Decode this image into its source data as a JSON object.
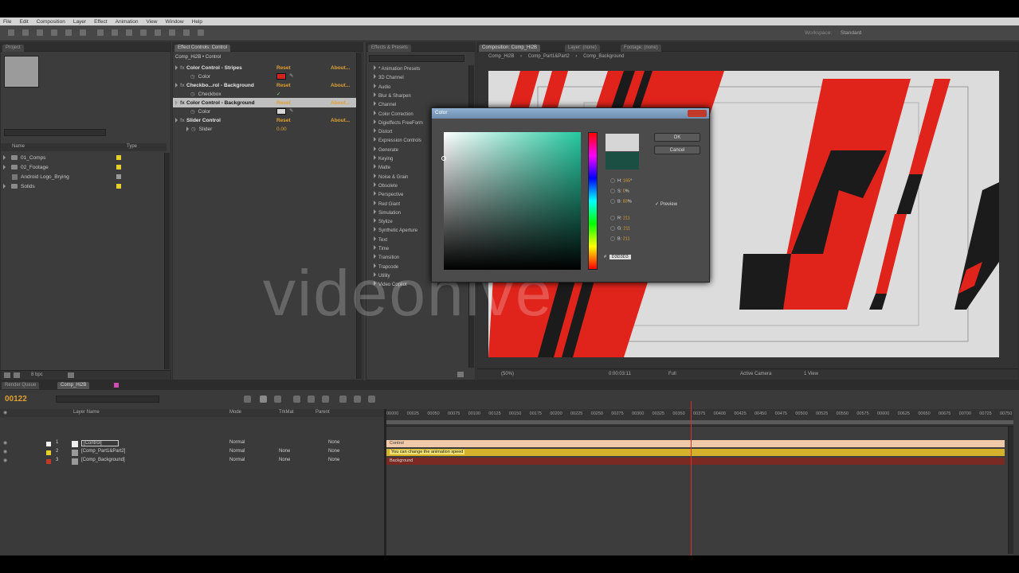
{
  "menubar": {
    "items": [
      "File",
      "Edit",
      "Composition",
      "Layer",
      "Effect",
      "Animation",
      "View",
      "Window",
      "Help"
    ]
  },
  "toolbar": {
    "workspace_label": "Workspace:",
    "workspace_value": "Standard"
  },
  "project": {
    "tab": "Project",
    "search_placeholder": "",
    "col_name": "Name",
    "col_type": "Type",
    "items": [
      {
        "label": "01_Comps",
        "type": "folder",
        "tag": "yellow"
      },
      {
        "label": "02_Footage",
        "type": "folder",
        "tag": "yellow"
      },
      {
        "label": "Android Logo_Brying",
        "type": "file",
        "tag": "grey"
      },
      {
        "label": "Solids",
        "type": "folder",
        "tag": "yellow"
      }
    ],
    "footer_label": "8 bpc"
  },
  "effect_controls": {
    "tab": "Effect Controls: Control",
    "header": "Comp_Hi2B • Control",
    "rows": [
      {
        "label": "Color Control - Stripes",
        "right1": "Reset",
        "right2": "About...",
        "kind": "effect"
      },
      {
        "label": "Color",
        "right1": "",
        "right2": "",
        "kind": "prop-color-red"
      },
      {
        "label": "Checkbo...rol - Background",
        "right1": "Reset",
        "right2": "About...",
        "kind": "effect"
      },
      {
        "label": "Checkbox",
        "right1": "",
        "right2": "",
        "kind": "prop-check"
      },
      {
        "label": "Color Control - Background",
        "right1": "Reset",
        "right2": "About...",
        "kind": "effect-selected"
      },
      {
        "label": "Color",
        "right1": "",
        "right2": "",
        "kind": "prop-color-grey"
      },
      {
        "label": "Slider Control",
        "right1": "Reset",
        "right2": "About...",
        "kind": "effect"
      },
      {
        "label": "Slider",
        "right1": "0.00",
        "right2": "",
        "kind": "prop-value"
      }
    ]
  },
  "effects_presets": {
    "tab": "Effects & Presets",
    "categories": [
      "* Animation Presets",
      "3D Channel",
      "Audio",
      "Blur & Sharpen",
      "Channel",
      "Color Correction",
      "Digieffects FreeForm",
      "Distort",
      "Expression Controls",
      "Generate",
      "Keying",
      "Matte",
      "Noise & Grain",
      "Obsolete",
      "Perspective",
      "Red Giant",
      "Simulation",
      "Stylize",
      "Synthetic Aperture",
      "Text",
      "Time",
      "Transition",
      "Trapcode",
      "Utility",
      "Video Copilot"
    ]
  },
  "composition": {
    "tabs": [
      "Composition: Comp_Hi2B",
      "Layer: (none)",
      "Footage: (none)"
    ],
    "breadcrumbs": [
      "Comp_Hi2B",
      "Comp_Part1&Part2",
      "Comp_Background"
    ],
    "zoom": "(50%)",
    "timecode": "0:00:03:11",
    "resolution": "Full",
    "camera": "Active Camera",
    "view": "1 View"
  },
  "color_dialog": {
    "title": "Color",
    "ok_label": "OK",
    "cancel_label": "Cancel",
    "preview_label": "Preview",
    "new_color": "#d6d6d6",
    "old_color": "#1b4f43",
    "fields": [
      {
        "label": "H:",
        "value": "165",
        "unit": "°"
      },
      {
        "label": "S:",
        "value": "0",
        "unit": "%"
      },
      {
        "label": "B:",
        "value": "83",
        "unit": "%"
      },
      {
        "label": "R:",
        "value": "211",
        "unit": ""
      },
      {
        "label": "G:",
        "value": "211",
        "unit": ""
      },
      {
        "label": "B:",
        "value": "211",
        "unit": ""
      }
    ],
    "hex_label": "#",
    "hex_value": "D3D3D3"
  },
  "timeline": {
    "tabs": [
      "Render Queue",
      "Comp_Hi2B"
    ],
    "timecode": "00122",
    "header": {
      "source": "Layer Name",
      "mode": "Mode",
      "trkmat": "TrkMat",
      "parent": "Parent"
    },
    "layers": [
      {
        "num": "1",
        "name": "[Control]",
        "mode": "Normal",
        "trkmat": "",
        "parent": "None",
        "color": "#f2f2f2"
      },
      {
        "num": "2",
        "name": "[Comp_Part1&Part2]",
        "mode": "Normal",
        "trkmat": "None",
        "parent": "None",
        "color": "#e8d02c"
      },
      {
        "num": "3",
        "name": "[Comp_Background]",
        "mode": "Normal",
        "trkmat": "None",
        "parent": "None",
        "color": "#c0392b"
      }
    ],
    "ruler_ticks": [
      "00000",
      "00025",
      "00050",
      "00075",
      "00100",
      "00125",
      "00150",
      "00175",
      "00200",
      "00225",
      "00250",
      "00275",
      "00300",
      "00325",
      "00350",
      "00375",
      "00400",
      "00425",
      "00450",
      "00475",
      "00500",
      "00525",
      "00550",
      "00575",
      "00600",
      "00625",
      "00650",
      "00675",
      "00700",
      "00725",
      "00750"
    ],
    "bars": [
      {
        "label": "Control",
        "color": "#f0c9a8"
      },
      {
        "label": "You can change the animation speed",
        "color": "#d6b22c"
      },
      {
        "label": "Background",
        "color": "#7a2a22"
      }
    ]
  },
  "watermark": "videohive"
}
